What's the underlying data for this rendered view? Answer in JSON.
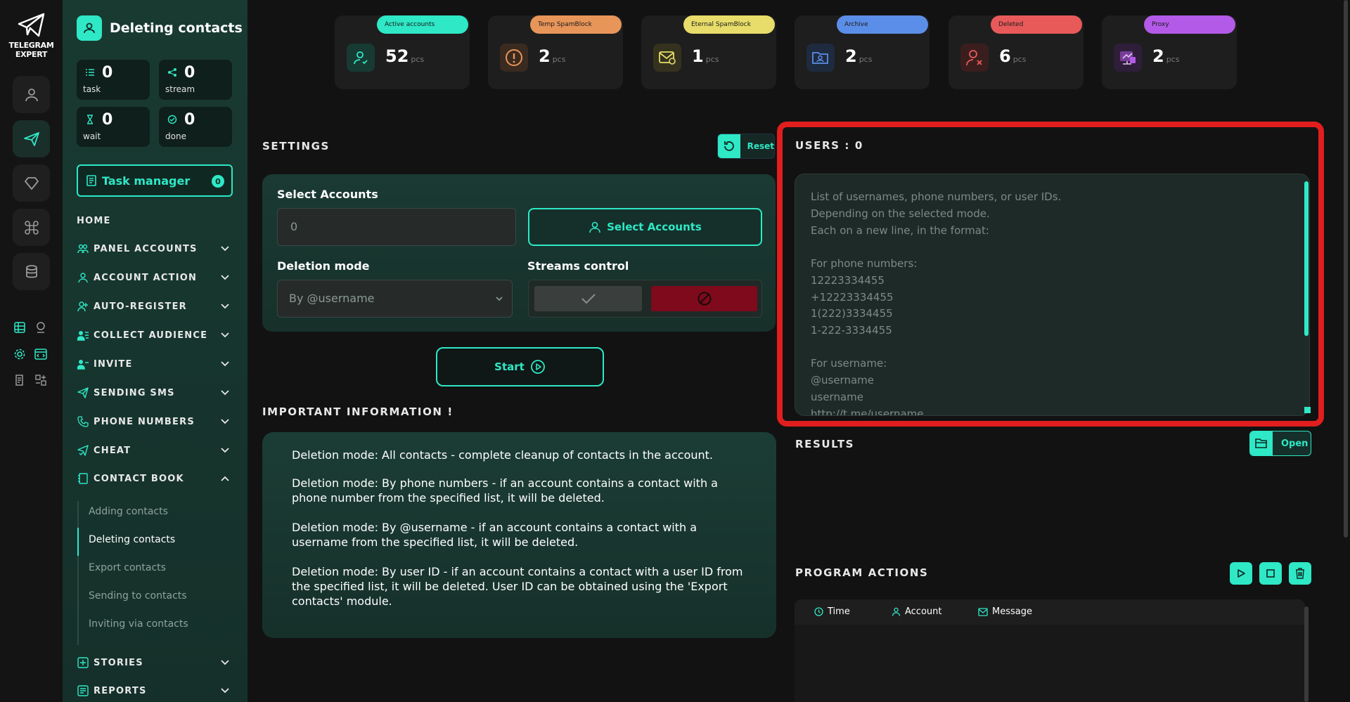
{
  "brand": {
    "line1": "TELEGRAM",
    "line2": "EXPERT"
  },
  "page_title": "Deleting contacts",
  "counters": [
    {
      "value": "0",
      "label": "task"
    },
    {
      "value": "0",
      "label": "stream"
    },
    {
      "value": "0",
      "label": "wait"
    },
    {
      "value": "0",
      "label": "done"
    }
  ],
  "task_manager": {
    "label": "Task manager",
    "badge": "0"
  },
  "nav": {
    "home": "HOME",
    "items": [
      "PANEL ACCOUNTS",
      "ACCOUNT ACTION",
      "AUTO-REGISTER",
      "COLLECT AUDIENCE",
      "INVITE",
      "SENDING SMS",
      "PHONE NUMBERS",
      "CHEAT",
      "CONTACT BOOK",
      "STORIES",
      "REPORTS"
    ],
    "contact_book_sub": [
      "Adding contacts",
      "Deleting contacts",
      "Export contacts",
      "Sending to contacts",
      "Inviting via contacts"
    ]
  },
  "stat_cards": [
    {
      "label": "Active accounts",
      "value": "52",
      "unit": "pcs",
      "color": "#2ee8c6",
      "icon": "user-check-icon"
    },
    {
      "label": "Temp SpamBlock",
      "value": "2",
      "unit": "pcs",
      "color": "#e8955a",
      "icon": "warning-icon"
    },
    {
      "label": "Eternal SpamBlock",
      "value": "1",
      "unit": "pcs",
      "color": "#e8dd6a",
      "icon": "mail-block-icon"
    },
    {
      "label": "Archive",
      "value": "2",
      "unit": "pcs",
      "color": "#5b8ee8",
      "icon": "folder-user-icon"
    },
    {
      "label": "Deleted",
      "value": "6",
      "unit": "pcs",
      "color": "#e85a5a",
      "icon": "user-x-icon"
    },
    {
      "label": "Proxy",
      "value": "2",
      "unit": "pcs",
      "color": "#b45ae8",
      "icon": "proxy-icon"
    }
  ],
  "settings": {
    "title": "SETTINGS",
    "reset_label": "Reset",
    "select_accounts_label": "Select Accounts",
    "accounts_value": "0",
    "select_accounts_button": "Select Accounts",
    "deletion_mode_label": "Deletion mode",
    "deletion_mode_value": "By @username",
    "streams_label": "Streams control",
    "start_label": "Start"
  },
  "info": {
    "title": "IMPORTANT INFORMATION !",
    "paragraphs": [
      "Deletion mode: All contacts - complete cleanup of contacts in the account.",
      "Deletion mode: By phone numbers - if an account contains a contact with a phone number from the specified list, it will be deleted.",
      "Deletion mode: By @username - if an account contains a contact with a username from the specified list, it will be deleted.",
      "Deletion mode: By user ID - if an account contains a contact with a user ID from the specified list, it will be deleted. User ID can be obtained using the 'Export contacts' module."
    ]
  },
  "users": {
    "title": "USERS : 0",
    "placeholder_lines": [
      "List of usernames, phone numbers, or user IDs.",
      "Depending on the selected mode.",
      "Each on a new line, in the format:",
      "",
      "For phone numbers:",
      "12223334455",
      "+12223334455",
      "1(222)3334455",
      "1-222-3334455",
      "",
      "For username:",
      "@username",
      "username",
      "http://t.me/username"
    ]
  },
  "results": {
    "title": "RESULTS",
    "open_label": "Open"
  },
  "program_actions": {
    "title": "PROGRAM ACTIONS",
    "columns": [
      "Time",
      "Account",
      "Message"
    ]
  },
  "colors": {
    "accent": "#2ee8c6",
    "highlight": "#e01e1e",
    "stop": "#7e0a1c"
  }
}
